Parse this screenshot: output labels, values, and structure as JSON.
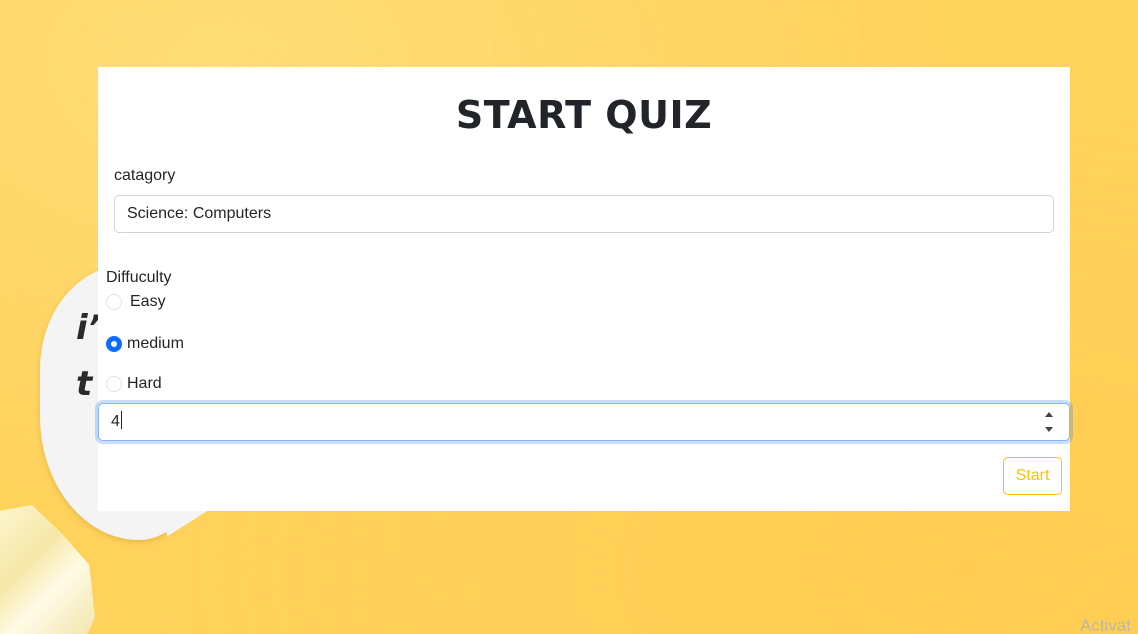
{
  "background": {
    "bubble_text": "i’\nt"
  },
  "quiz": {
    "title": "START QUIZ",
    "category_label": "catagory",
    "category_value": "Science: Computers",
    "difficulty_label": "Diffuculty",
    "options": [
      {
        "label": "Easy",
        "checked": false
      },
      {
        "label": "medium",
        "checked": true
      },
      {
        "label": "Hard",
        "checked": false
      }
    ],
    "amount_value": "4",
    "start_label": "Start"
  },
  "watermark": "Activat",
  "colors": {
    "background": "#ffd25c",
    "accent": "#0d6efd",
    "start_button": "#ffc107"
  },
  "icons": [
    "spinner-up-icon",
    "spinner-down-icon"
  ]
}
